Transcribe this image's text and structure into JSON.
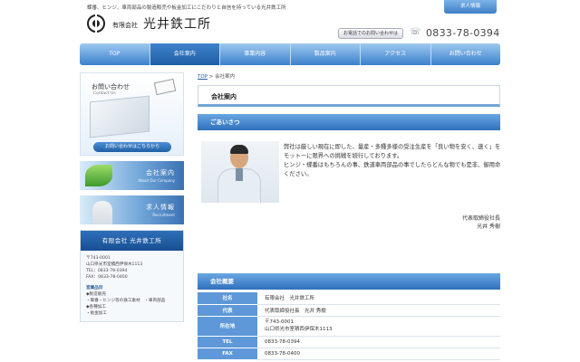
{
  "header": {
    "tagline": "蝶番、ヒンジ、車両部品の製造販売や板金加工にこだわりと自信を持っている光井鉄工所",
    "company_prefix": "有限会社",
    "company_name": "光井鉄工所",
    "recruit_tab": "求人情報",
    "phone_label": "お電話でのお問い合わせは",
    "phone_number": "0833-78-0394"
  },
  "nav": {
    "items": [
      "TOP",
      "会社案内",
      "事業内容",
      "製品案内",
      "アクセス",
      "お問い合わせ"
    ],
    "active_index": 1
  },
  "sidebar": {
    "contact": {
      "title": "お問い合わせ",
      "subtitle": "Contact Us",
      "button": "お問い合わせはこちらから"
    },
    "banner_company": {
      "title": "会社案内",
      "subtitle": "About Our Company"
    },
    "banner_recruit": {
      "title": "求人情報",
      "subtitle": "Recruitment"
    },
    "info": {
      "heading": "有限会社  光井鉄工所",
      "postal": "〒743-0001",
      "address": "山口県光市室積西伊保木1113",
      "tel": "TEL：0833-78-0394",
      "fax": "FAX：0833-78-0400",
      "products_label": "営業品目",
      "products": [
        "◆製造販売",
        "・蝶番・ヒンジ等の鉄工素材　・車両部品",
        "◆各種加工",
        "・板金加工"
      ]
    }
  },
  "breadcrumb": {
    "home": "TOP",
    "separator": ">",
    "current": "会社案内"
  },
  "page": {
    "title": "会社案内",
    "greeting_heading": "ごあいさつ",
    "greeting_p1": "弊社は厳しい現在に即した、量産・多種多様の受注生産を「良い物を安く、速く」をモットーに限界への挑戦を続行しております。",
    "greeting_p2": "ヒンジ・蝶番はもちろんの事、鉄道車両部品の事でしたらどんな物でも是非、御用命ください。",
    "sign_title": "代表取締役社長",
    "sign_name": "光井 秀樹",
    "overview_heading": "会社概要"
  },
  "overview": {
    "rows": [
      {
        "label": "社名",
        "value": "有限会社　光井鉄工所"
      },
      {
        "label": "代表",
        "value": "代表取締役社長　光井 秀樹"
      },
      {
        "label": "所在地",
        "value": "〒743-0001",
        "value2": "山口県光市室積西伊保木1113"
      },
      {
        "label": "TEL",
        "value": "0833-78-0394"
      },
      {
        "label": "FAX",
        "value": "0833-78-0400"
      }
    ]
  },
  "colors": {
    "nav_blue": "#3b80cc",
    "section_blue": "#2f71bc",
    "table_header": "#5e98d8"
  },
  "icons": {
    "logo": "company-logo-icon",
    "phone": "phone-icon"
  }
}
